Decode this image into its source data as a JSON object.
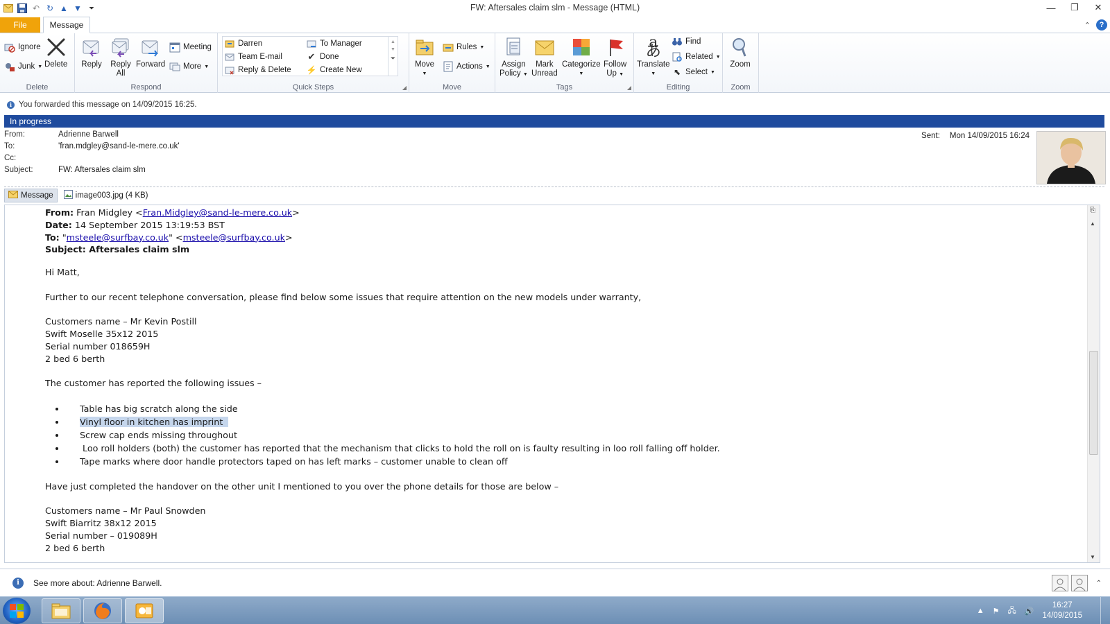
{
  "window": {
    "title": "FW: Aftersales claim slm  -  Message (HTML)",
    "controls": [
      "minimize-icon",
      "restore-icon",
      "close-icon"
    ]
  },
  "quick_access": [
    "save-icon",
    "undo-icon",
    "redo-icon",
    "up-arrow-icon",
    "down-arrow-icon",
    "customize-icon"
  ],
  "tabs": {
    "file": "File",
    "message": "Message"
  },
  "ribbon": {
    "delete_group": {
      "label": "Delete",
      "ignore": "Ignore",
      "junk": "Junk",
      "delete": "Delete"
    },
    "respond_group": {
      "label": "Respond",
      "reply": "Reply",
      "reply_all_1": "Reply",
      "reply_all_2": "All",
      "forward": "Forward",
      "meeting": "Meeting",
      "more": "More"
    },
    "quick_steps": {
      "label": "Quick Steps",
      "items": [
        "Darren",
        "To Manager",
        "Team E-mail",
        "Done",
        "Reply & Delete",
        "Create New"
      ]
    },
    "move_group": {
      "label": "Move",
      "move": "Move",
      "rules": "Rules",
      "actions": "Actions"
    },
    "tags_group": {
      "label": "Tags",
      "assign_1": "Assign",
      "assign_2": "Policy",
      "mark_1": "Mark",
      "mark_2": "Unread",
      "categorize": "Categorize",
      "follow_1": "Follow",
      "follow_2": "Up"
    },
    "editing_group": {
      "label": "Editing",
      "translate": "Translate",
      "find": "Find",
      "related": "Related",
      "select": "Select"
    },
    "zoom_group": {
      "label": "Zoom",
      "zoom": "Zoom"
    }
  },
  "notices": {
    "forwarded": "You forwarded this message on 14/09/2015 16:25.",
    "status": "In progress"
  },
  "header": {
    "from_label": "From:",
    "from": "Adrienne Barwell",
    "to_label": "To:",
    "to": "'fran.mdgley@sand-le-mere.co.uk'",
    "cc_label": "Cc:",
    "cc": "",
    "subject_label": "Subject:",
    "subject": "FW: Aftersales claim slm",
    "sent_label": "Sent:",
    "sent": "Mon 14/09/2015 16:24"
  },
  "attachments": {
    "message_tab": "Message",
    "file": "image003.jpg (4 KB)"
  },
  "body": {
    "fwd_from_label": "From:",
    "fwd_from_name": "Fran Midgley <",
    "fwd_from_email": "Fran.Midgley@sand-le-mere.co.uk",
    "fwd_from_close": ">",
    "fwd_date_label": "Date:",
    "fwd_date": "14 September 2015 13:19:53 BST",
    "fwd_to_label": "To:",
    "fwd_to_q1": "\"",
    "fwd_to_email1": "msteele@surfbay.co.uk",
    "fwd_to_q2": "\" <",
    "fwd_to_email2": "msteele@surfbay.co.uk",
    "fwd_to_close": ">",
    "fwd_subject": "Subject: Aftersales claim slm",
    "greeting": "Hi Matt,",
    "intro": "Further to our recent telephone conversation, please find below some issues that require attention on the new models under warranty,",
    "customer1": [
      "Customers name – Mr Kevin Postill",
      "Swift Moselle 35x12 2015",
      "Serial number 018659H",
      "2 bed 6 berth"
    ],
    "issues_intro": "The customer has reported the following issues –",
    "issues": [
      "Table has big scratch along the side",
      "Vinyl floor in kitchen has imprint",
      "Screw cap ends missing throughout",
      " Loo roll holders (both) the customer has reported that the mechanism that clicks to hold the roll on is faulty resulting in loo roll falling off holder.",
      "Tape marks where door handle protectors taped on has left marks – customer unable to clean off"
    ],
    "handover": "Have just completed the handover on the other unit I mentioned to you over the phone details for those are below –",
    "customer2": [
      "Customers name – Mr Paul Snowden",
      "Swift Biarritz 38x12 2015",
      "Serial number – 019089H",
      "2 bed 6 berth"
    ]
  },
  "people_pane": {
    "text": "See more about: Adrienne Barwell."
  },
  "taskbar": {
    "time": "16:27",
    "date": "14/09/2015",
    "apps": [
      "file-explorer-icon",
      "firefox-icon",
      "outlook-icon"
    ]
  }
}
